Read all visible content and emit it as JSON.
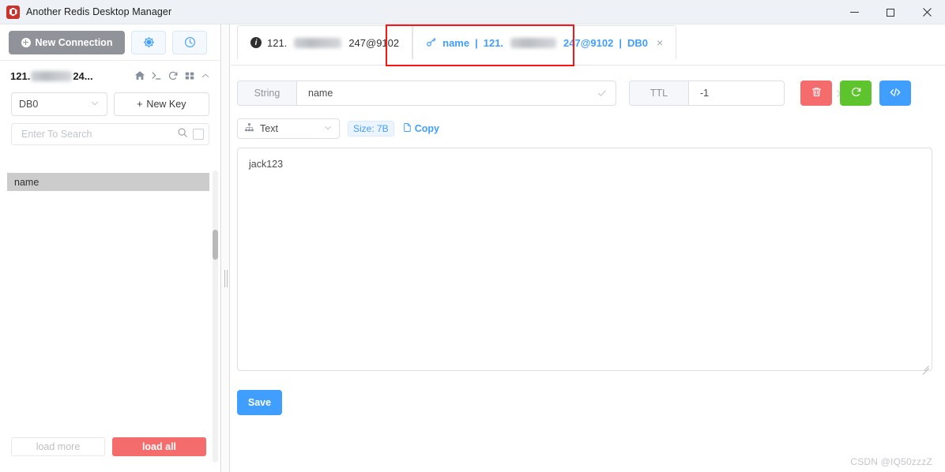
{
  "window": {
    "title": "Another Redis Desktop Manager",
    "logo_icon": "redis-logo-icon",
    "minimize_label": "Minimize",
    "maximize_label": "Maximize",
    "close_label": "Close"
  },
  "sidebar": {
    "new_connection_label": "New Connection",
    "settings_icon": "gear-icon",
    "history_icon": "clock-icon",
    "connection": {
      "name_prefix": "121.",
      "name_suffix": "24...",
      "masked": true,
      "tools": [
        {
          "name": "home-icon",
          "title": "Home"
        },
        {
          "name": "terminal-icon",
          "title": "Console"
        },
        {
          "name": "refresh-icon",
          "title": "Refresh"
        },
        {
          "name": "grid-icon",
          "title": "Grid"
        },
        {
          "name": "chevron-up-icon",
          "title": "Collapse"
        }
      ]
    },
    "db_selected": "DB0",
    "new_key_label": "New Key",
    "search_placeholder": "Enter To Search",
    "search_value": "",
    "keys": [
      {
        "label": "name",
        "selected": true
      }
    ],
    "load_more_label": "load more",
    "load_all_label": "load all"
  },
  "tabs": [
    {
      "icon": "info-icon",
      "prefix": "121.",
      "suffix": "247@9102",
      "active": false,
      "closable": false,
      "masked": true
    },
    {
      "icon": "key-icon",
      "key_name": "name",
      "separator": "|",
      "prefix": "121.",
      "suffix": "247@9102",
      "db": "DB0",
      "close_label": "×",
      "active": true,
      "closable": true,
      "masked": true,
      "highlighted": true
    }
  ],
  "key_toolbar": {
    "type_label": "String",
    "key_value": "name",
    "key_confirm_icon": "check-icon",
    "ttl_label": "TTL",
    "ttl_value": "-1",
    "ttl_clear_icon": "close-icon",
    "ttl_confirm_icon": "check-icon",
    "actions": [
      {
        "name": "delete-key-button",
        "icon": "trash-icon",
        "color": "#f56c6c"
      },
      {
        "name": "refresh-value-button",
        "icon": "refresh-icon",
        "color": "#5dc42e"
      },
      {
        "name": "format-code-button",
        "icon": "code-icon",
        "color": "#409eff"
      }
    ]
  },
  "value_panel": {
    "format_icon": "sitemap-icon",
    "format_selected": "Text",
    "size_label": "Size: 7B",
    "copy_label": "Copy",
    "copy_icon": "copy-icon",
    "value": "jack123",
    "save_label": "Save"
  },
  "watermark": "CSDN @IQ50zzzZ",
  "colors": {
    "accent_blue": "#409eff",
    "danger_red": "#f56c6c",
    "success_green": "#5dc42e",
    "highlight_red": "#fb1414",
    "muted_gray": "#909399"
  }
}
